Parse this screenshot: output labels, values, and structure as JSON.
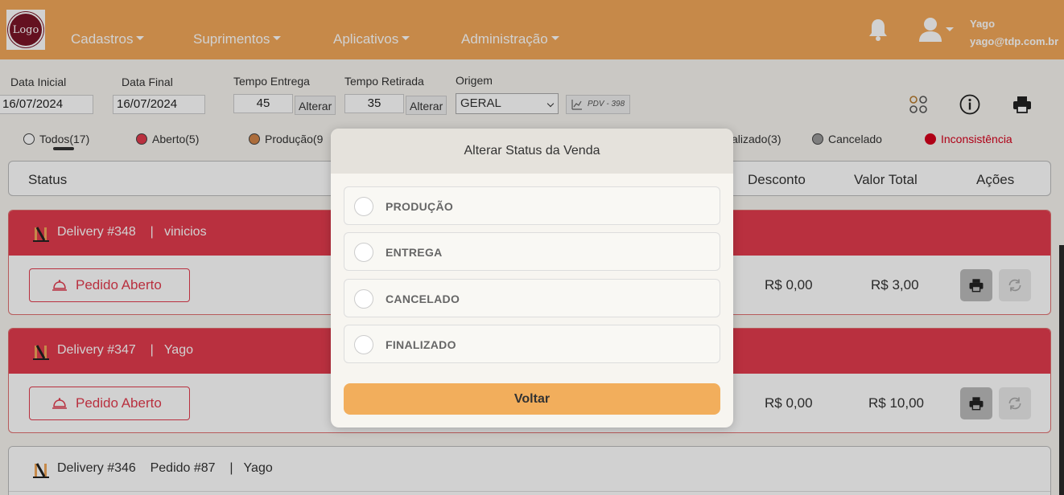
{
  "app": {
    "logo_text": "Logo"
  },
  "nav": {
    "items": [
      {
        "label": "Cadastros"
      },
      {
        "label": "Suprimentos"
      },
      {
        "label": "Aplicativos"
      },
      {
        "label": "Administração"
      }
    ],
    "user_name": "Yago",
    "user_email": "yago@tdp.com.br"
  },
  "filters": {
    "data_inicial_label": "Data Inicial",
    "data_inicial_value": "16/07/2024",
    "data_final_label": "Data Final",
    "data_final_value": "16/07/2024",
    "tempo_entrega_label": "Tempo Entrega",
    "tempo_entrega_value": "45",
    "tempo_retirada_label": "Tempo Retirada",
    "tempo_retirada_value": "35",
    "alterar_label": "Alterar",
    "origem_label": "Origem",
    "origem_value": "GERAL",
    "pdv_label": "PDV - 398"
  },
  "legend": [
    {
      "label": "Todos(17)",
      "color": "#ffffff"
    },
    {
      "label": "Aberto(5)",
      "color": "#e23b4e"
    },
    {
      "label": "Produção(9",
      "color": "#d2864a"
    },
    {
      "label": "alizado(3)",
      "color": "#ffffff"
    },
    {
      "label": "Cancelado",
      "color": "#9a9a9a"
    },
    {
      "label": "Inconsistência",
      "color": "#d6001c"
    }
  ],
  "table_header": {
    "status": "Status",
    "desconto": "Desconto",
    "valor_total": "Valor Total",
    "acoes": "Ações"
  },
  "orders": [
    {
      "title": "Delivery #348    |   vinicios",
      "status_label": "Pedido Aberto",
      "desconto": "R$ 0,00",
      "valor_total": "R$ 3,00"
    },
    {
      "title": "Delivery #347    |   Yago",
      "status_label": "Pedido Aberto",
      "desconto": "R$ 0,00",
      "valor_total": "R$ 10,00"
    },
    {
      "title": "Delivery #346    Pedido #87    |   Yago"
    }
  ],
  "modal": {
    "title": "Alterar Status da Venda",
    "options": [
      {
        "label": "PRODUÇÃO"
      },
      {
        "label": "ENTREGA"
      },
      {
        "label": "CANCELADO"
      },
      {
        "label": "FINALIZADO"
      }
    ],
    "back_label": "Voltar"
  },
  "colors": {
    "navbar": "#f2a859",
    "open_status": "#e23b4e",
    "button_back": "#f2ae5c"
  },
  "icons": {
    "bell": "bell-icon",
    "user": "user-icon",
    "grid": "grid-icon",
    "info": "info-icon",
    "print": "printer-icon",
    "sync": "sync-icon",
    "cloche": "cloche-icon"
  }
}
